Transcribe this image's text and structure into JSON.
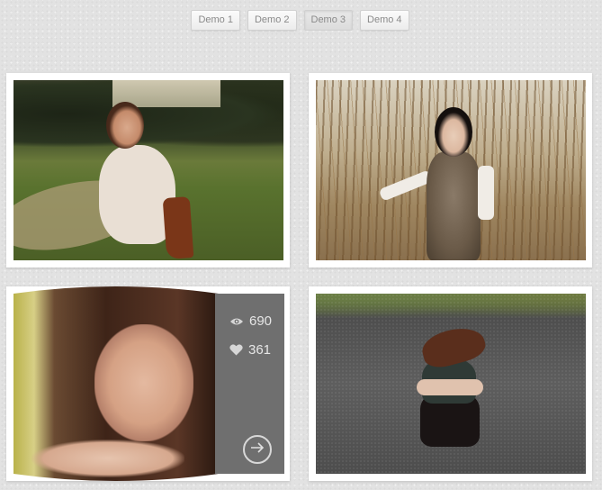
{
  "nav": {
    "demos": [
      "Demo 1",
      "Demo 2",
      "Demo 3",
      "Demo 4"
    ]
  },
  "gallery": {
    "card3": {
      "views": "690",
      "likes": "361"
    }
  },
  "colors": {
    "background": "#e2e2e2",
    "overlay_panel": "#6f6f6f",
    "card": "#ffffff"
  },
  "icons": {
    "views": "eye-icon",
    "likes": "heart-icon",
    "more": "arrow-right-circle-icon"
  }
}
